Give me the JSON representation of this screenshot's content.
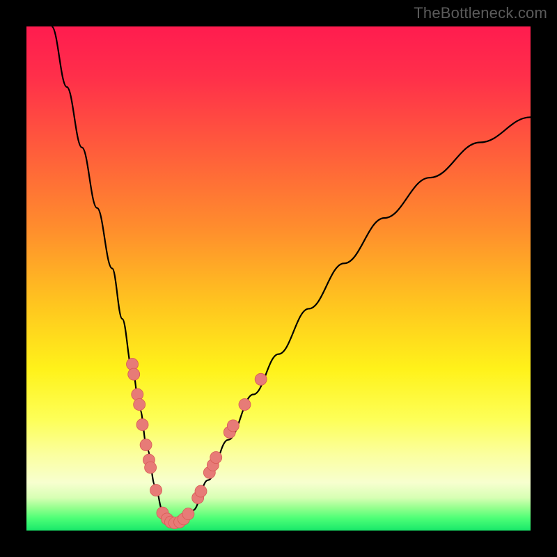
{
  "credit_text": "TheBottleneck.com",
  "colors": {
    "frame": "#000000",
    "credit": "#5b5b5b",
    "curve": "#000000",
    "dot_fill": "#e77b77",
    "dot_stroke": "#d85a55"
  },
  "gradient_stops": [
    {
      "offset": 0.0,
      "color": "#ff1c4f"
    },
    {
      "offset": 0.1,
      "color": "#ff2f4a"
    },
    {
      "offset": 0.25,
      "color": "#ff5e3b"
    },
    {
      "offset": 0.4,
      "color": "#ff8d2d"
    },
    {
      "offset": 0.55,
      "color": "#ffc51f"
    },
    {
      "offset": 0.68,
      "color": "#fff21a"
    },
    {
      "offset": 0.78,
      "color": "#fdff58"
    },
    {
      "offset": 0.85,
      "color": "#fbffa0"
    },
    {
      "offset": 0.905,
      "color": "#f7ffcf"
    },
    {
      "offset": 0.935,
      "color": "#d7ffb4"
    },
    {
      "offset": 0.955,
      "color": "#95ff8e"
    },
    {
      "offset": 0.975,
      "color": "#4fff77"
    },
    {
      "offset": 1.0,
      "color": "#18e86a"
    }
  ],
  "chart_data": {
    "type": "line",
    "title": "",
    "xlabel": "",
    "ylabel": "",
    "xlim": [
      0,
      100
    ],
    "ylim": [
      0,
      100
    ],
    "series": [
      {
        "name": "bottleneck-curve",
        "x": [
          5,
          8,
          11,
          14,
          17,
          19,
          21,
          22.5,
          24,
          25.5,
          27,
          28.5,
          30,
          33,
          36,
          40,
          45,
          50,
          56,
          63,
          71,
          80,
          90,
          100
        ],
        "y": [
          100,
          88,
          76,
          64,
          52,
          42,
          32,
          24,
          16,
          9,
          4,
          1.5,
          1.5,
          4,
          10,
          18,
          27,
          35,
          44,
          53,
          62,
          70,
          77,
          82
        ]
      }
    ],
    "points": [
      {
        "name": "left-branch-dot",
        "x": 21.0,
        "y": 33
      },
      {
        "name": "left-branch-dot",
        "x": 21.3,
        "y": 31
      },
      {
        "name": "left-branch-dot",
        "x": 22.0,
        "y": 27
      },
      {
        "name": "left-branch-dot",
        "x": 22.4,
        "y": 25
      },
      {
        "name": "left-branch-dot",
        "x": 23.0,
        "y": 21
      },
      {
        "name": "left-branch-dot",
        "x": 23.7,
        "y": 17
      },
      {
        "name": "left-branch-dot",
        "x": 24.3,
        "y": 14
      },
      {
        "name": "left-branch-dot",
        "x": 24.6,
        "y": 12.5
      },
      {
        "name": "left-branch-dot",
        "x": 25.7,
        "y": 8
      },
      {
        "name": "bottom-dot",
        "x": 27.0,
        "y": 3.5
      },
      {
        "name": "bottom-dot",
        "x": 27.9,
        "y": 2.3
      },
      {
        "name": "bottom-dot",
        "x": 28.6,
        "y": 1.7
      },
      {
        "name": "bottom-dot",
        "x": 29.4,
        "y": 1.5
      },
      {
        "name": "bottom-dot",
        "x": 30.4,
        "y": 1.7
      },
      {
        "name": "bottom-dot",
        "x": 31.2,
        "y": 2.3
      },
      {
        "name": "bottom-dot",
        "x": 32.1,
        "y": 3.3
      },
      {
        "name": "right-branch-dot",
        "x": 34.0,
        "y": 6.5
      },
      {
        "name": "right-branch-dot",
        "x": 34.6,
        "y": 7.8
      },
      {
        "name": "right-branch-dot",
        "x": 36.3,
        "y": 11.5
      },
      {
        "name": "right-branch-dot",
        "x": 37.0,
        "y": 13
      },
      {
        "name": "right-branch-dot",
        "x": 37.6,
        "y": 14.5
      },
      {
        "name": "right-branch-dot",
        "x": 40.3,
        "y": 19.5
      },
      {
        "name": "right-branch-dot",
        "x": 41.0,
        "y": 20.8
      },
      {
        "name": "right-branch-dot",
        "x": 43.3,
        "y": 25
      },
      {
        "name": "right-branch-dot",
        "x": 46.5,
        "y": 30
      }
    ]
  }
}
